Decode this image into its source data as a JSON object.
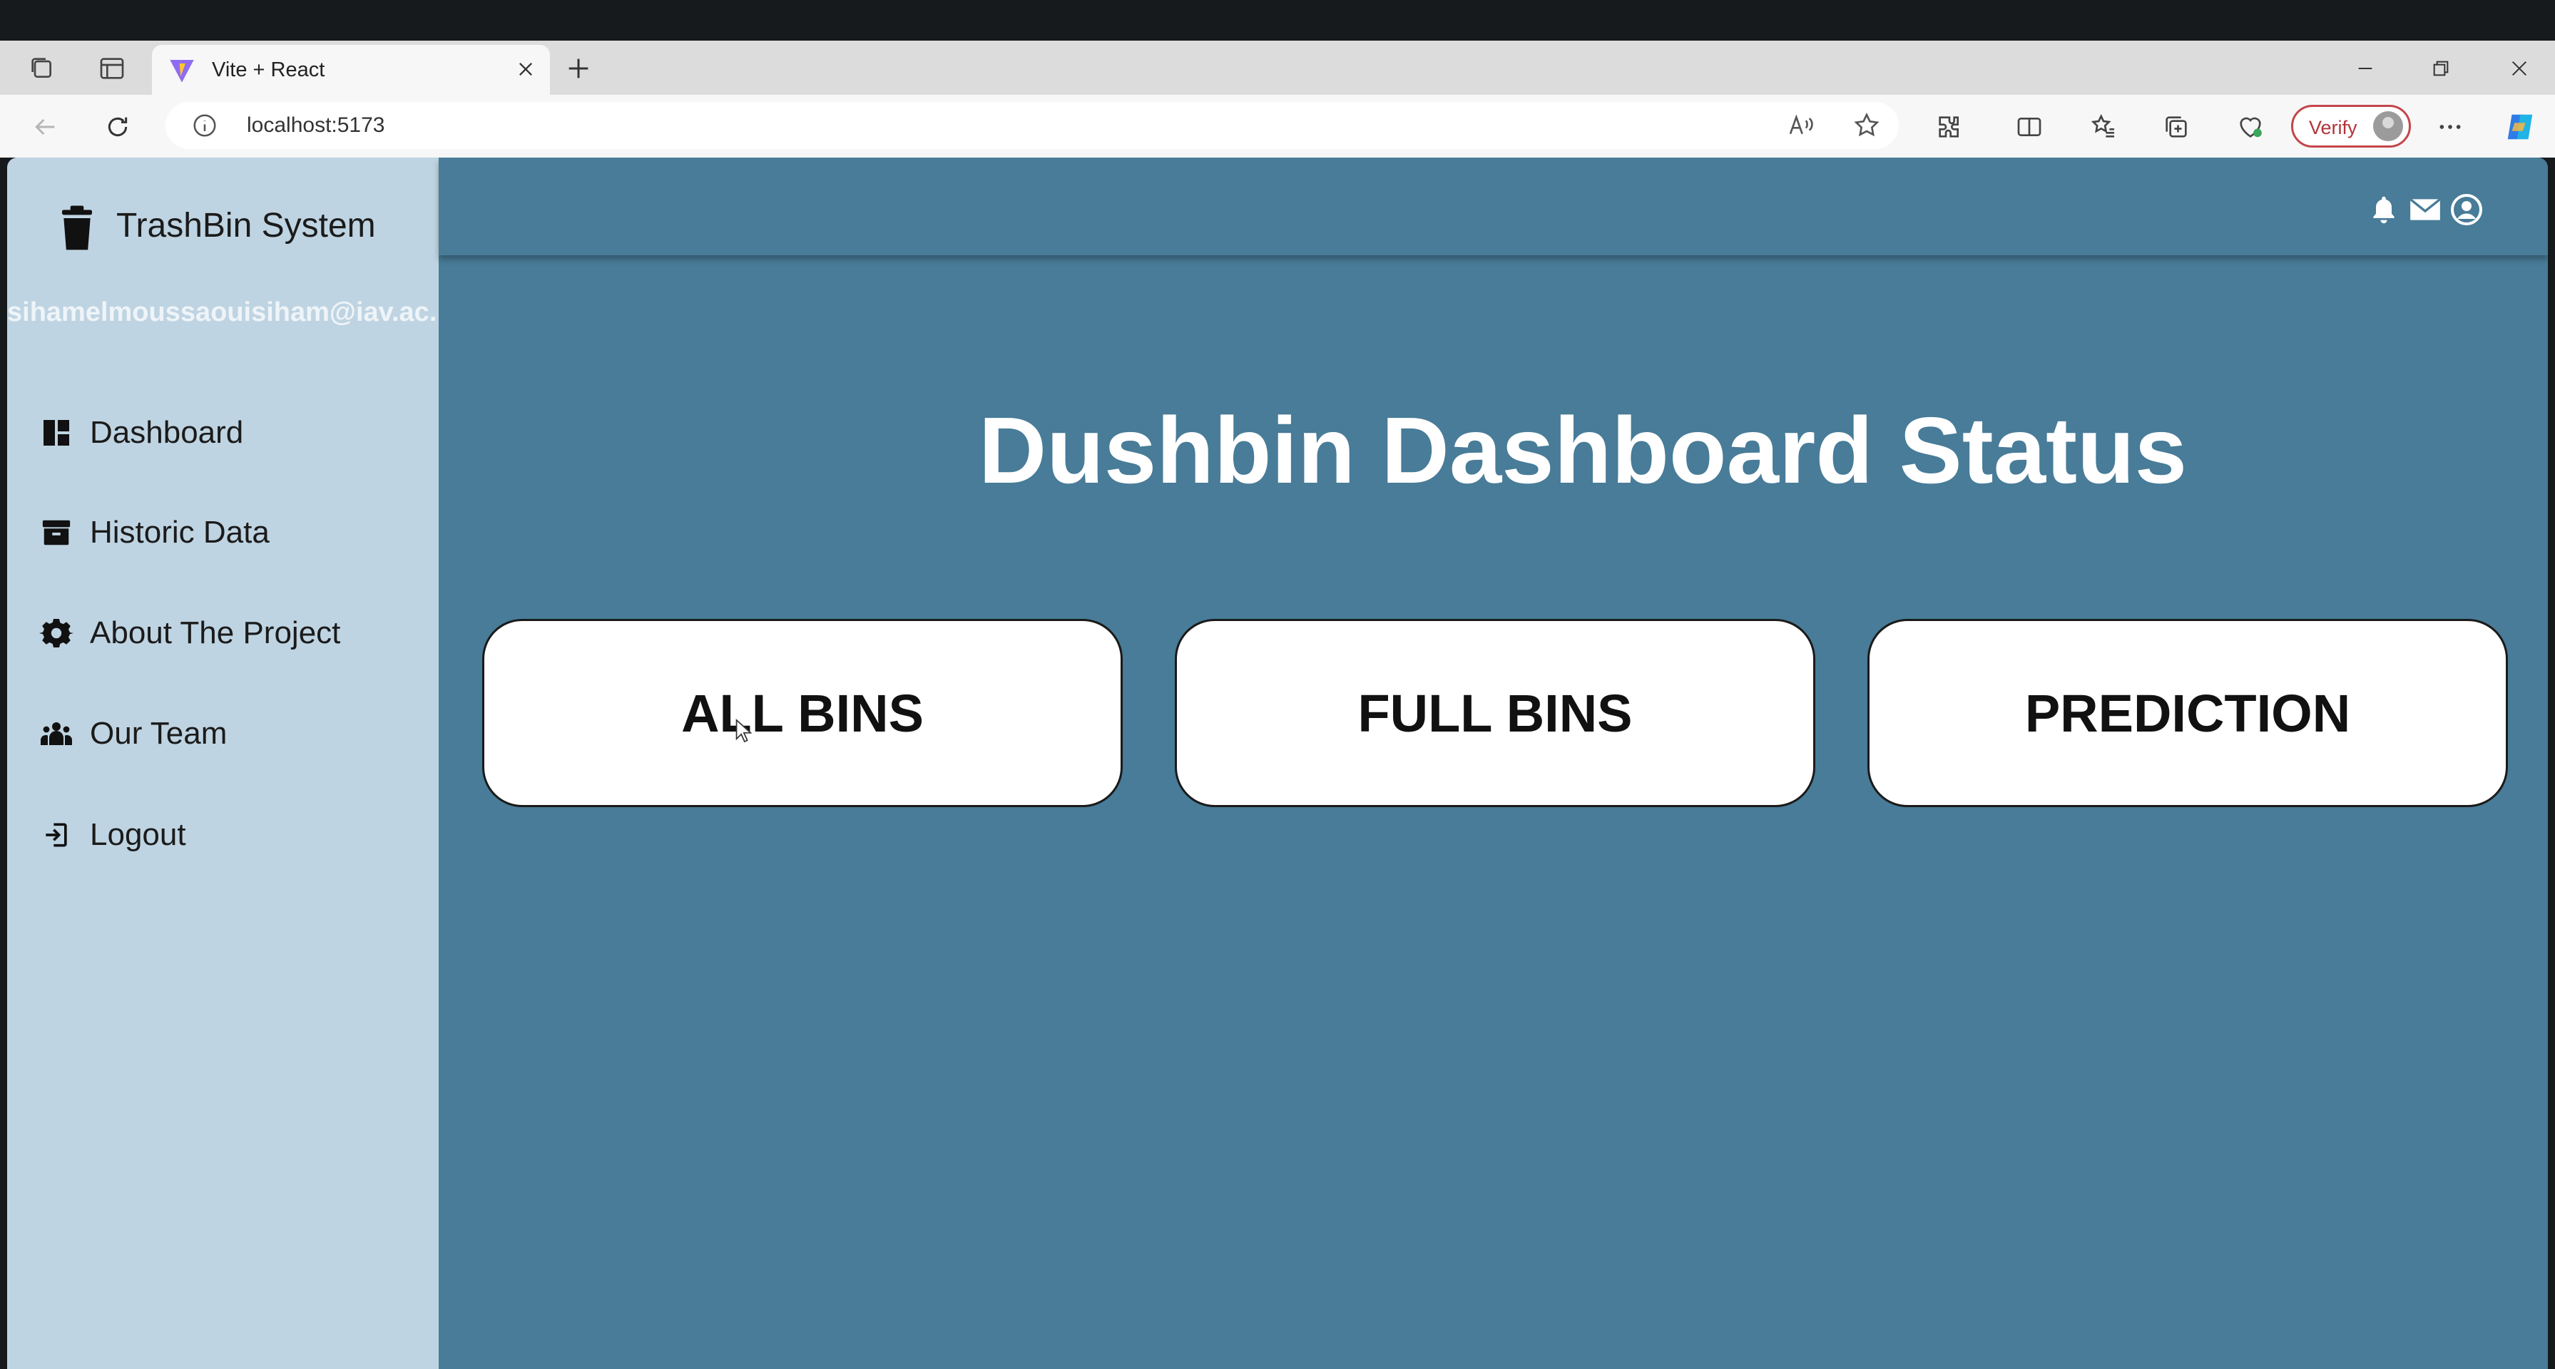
{
  "browser": {
    "tab_title": "Vite + React",
    "url": "localhost:5173",
    "verify_label": "Verify"
  },
  "sidebar": {
    "brand": "TrashBin System",
    "email": "sihamelmoussaouisiham@iav.ac.ma",
    "items": [
      {
        "label": "Dashboard",
        "icon": "dashboard-icon"
      },
      {
        "label": "Historic Data",
        "icon": "archive-icon"
      },
      {
        "label": "About The Project",
        "icon": "gear-icon"
      },
      {
        "label": "Our Team",
        "icon": "team-icon"
      },
      {
        "label": "Logout",
        "icon": "logout-icon"
      }
    ]
  },
  "topbar": {
    "icons": [
      "bell-icon",
      "mail-icon",
      "user-circle-icon"
    ]
  },
  "main": {
    "title": "Dushbin Dashboard Status",
    "cards": [
      {
        "label": "ALL BINS"
      },
      {
        "label": "FULL BINS"
      },
      {
        "label": "PREDICTION"
      }
    ]
  },
  "colors": {
    "main_bg": "#487c98",
    "sidebar_bg": "#bfd4e2",
    "card_bg": "#ffffff",
    "verify_border": "#c4464a"
  }
}
